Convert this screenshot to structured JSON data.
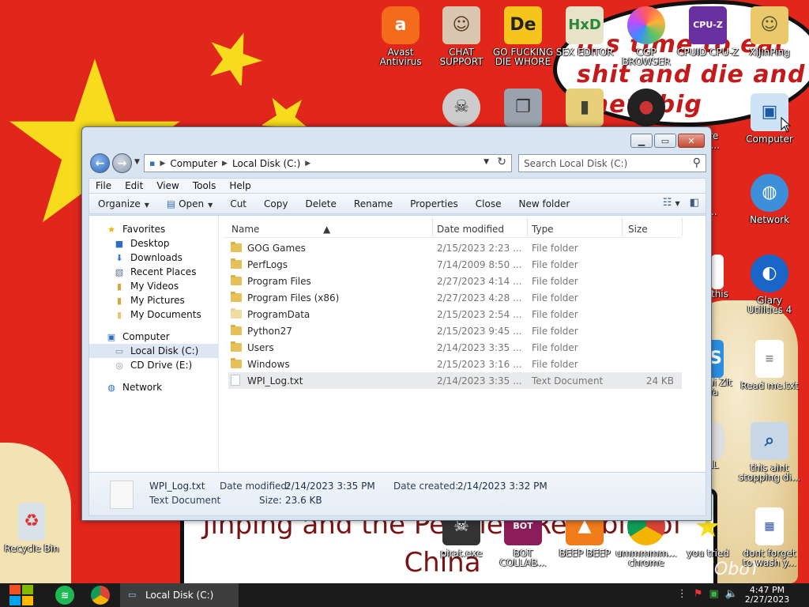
{
  "wallpaper": {
    "text_top": "it's time to eat shit and die and chew big chungus",
    "text_bottom": "Jinping and the People's Republic of China",
    "watermark": "VMOboT"
  },
  "desktop_icons": {
    "avast": "Avast Antivirus",
    "chat": "CHAT SUPPORT",
    "die": "GO FUCKING DIE WHORE",
    "hex": "SEX EDITOR",
    "cgp": "CGP BROWSER",
    "cpuz": "CPUID CPU-Z",
    "xijinping": "XiJinPing",
    "computer": "Computer",
    "software": "ware",
    "software2": "ote...",
    "network": "Network",
    "ed": "ed",
    "ed2": "er ...",
    "glary": "Glary Utilities 4",
    "this": "this",
    "readme": "Read me.txt",
    "zit": "ai Zit",
    "ya": "Ya",
    "thisaint": "this aint stopping di...",
    "ll": "LL",
    "recycle": "Recycle Bin",
    "pirat": "pirat.exe",
    "bot": "BOT COLLAB...",
    "beep": "BEEP BEEP",
    "chrome": "ummmmm... chrome",
    "youtried": "you tried",
    "dontforget": "dont forget to wash y..."
  },
  "explorer": {
    "breadcrumb": [
      "Computer",
      "Local Disk (C:)"
    ],
    "search_placeholder": "Search Local Disk (C:)",
    "menu": [
      "File",
      "Edit",
      "View",
      "Tools",
      "Help"
    ],
    "toolbar": {
      "organize": "Organize",
      "open": "Open",
      "cut": "Cut",
      "copy": "Copy",
      "delete": "Delete",
      "rename": "Rename",
      "properties": "Properties",
      "close": "Close",
      "new_folder": "New folder"
    },
    "nav": {
      "favorites": "Favorites",
      "desktop": "Desktop",
      "downloads": "Downloads",
      "recent": "Recent Places",
      "videos": "My Videos",
      "pictures": "My Pictures",
      "documents": "My Documents",
      "computer": "Computer",
      "local_disk": "Local Disk (C:)",
      "cd_drive": "CD Drive (E:)",
      "network": "Network"
    },
    "columns": {
      "name": "Name",
      "date": "Date modified",
      "type": "Type",
      "size": "Size"
    },
    "files": [
      {
        "name": "GOG Games",
        "date": "2/15/2023 2:23 ...",
        "type": "File folder",
        "size": ""
      },
      {
        "name": "PerfLogs",
        "date": "7/14/2009 8:50 ...",
        "type": "File folder",
        "size": ""
      },
      {
        "name": "Program Files",
        "date": "2/27/2023 4:14 ...",
        "type": "File folder",
        "size": ""
      },
      {
        "name": "Program Files (x86)",
        "date": "2/27/2023 4:28 ...",
        "type": "File folder",
        "size": ""
      },
      {
        "name": "ProgramData",
        "date": "2/15/2023 2:54 ...",
        "type": "File folder",
        "size": ""
      },
      {
        "name": "Python27",
        "date": "2/15/2023 9:45 ...",
        "type": "File folder",
        "size": ""
      },
      {
        "name": "Users",
        "date": "2/14/2023 3:35 ...",
        "type": "File folder",
        "size": ""
      },
      {
        "name": "Windows",
        "date": "2/15/2023 3:16 ...",
        "type": "File folder",
        "size": ""
      },
      {
        "name": "WPI_Log.txt",
        "date": "2/14/2023 3:35 ...",
        "type": "Text Document",
        "size": "24 KB"
      }
    ],
    "details": {
      "name": "WPI_Log.txt",
      "kind": "Text Document",
      "modified_label": "Date modified:",
      "modified_value": "2/14/2023 3:35 PM",
      "created_label": "Date created:",
      "created_value": "2/14/2023 3:32 PM",
      "size_label": "Size:",
      "size_value": "23.6 KB"
    }
  },
  "taskbar": {
    "active_task": "Local Disk (C:)",
    "time": "4:47 PM",
    "date": "2/27/2023"
  },
  "colors": {
    "wallpaper_red": "#e1261c",
    "star_yellow": "#f6dc1c",
    "selection": "#dde7f3",
    "taskbar": "#1b1b1b"
  }
}
